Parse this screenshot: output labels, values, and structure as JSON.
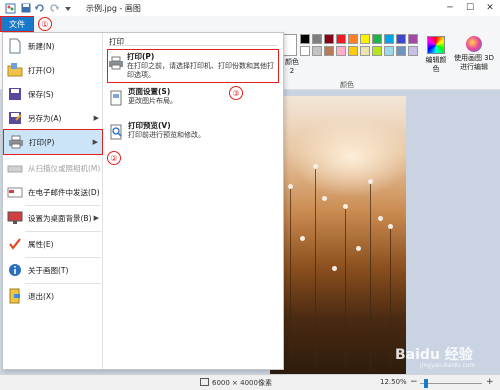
{
  "window": {
    "title": "示例.jpg - 画图",
    "controls": {
      "minimize": "─",
      "maximize": "☐",
      "close": "✕"
    }
  },
  "ribbon": {
    "file_tab": "文件",
    "color2_label": "颜色 2",
    "colors_label": "颜色",
    "edit_colors_label": "编辑颜色",
    "paint3d_label": "使用画图 3D 进行编辑",
    "swatches": [
      "#000000",
      "#7f7f7f",
      "#880015",
      "#ed1c24",
      "#ff7f27",
      "#fff200",
      "#22b14c",
      "#00a2e8",
      "#3f48cc",
      "#a349a4",
      "#ffffff",
      "#c3c3c3",
      "#b97a57",
      "#ffaec9",
      "#ffc90e",
      "#efe4b0",
      "#b5e61d",
      "#99d9ea",
      "#7092be",
      "#c8bfe7"
    ]
  },
  "file_menu": {
    "items": [
      {
        "label": "新建(N)",
        "icon": "new-file-icon",
        "disabled": false,
        "submenu": false
      },
      {
        "label": "打开(O)",
        "icon": "open-folder-icon",
        "disabled": false,
        "submenu": false
      },
      {
        "label": "保存(S)",
        "icon": "save-icon",
        "disabled": false,
        "submenu": false
      },
      {
        "label": "另存为(A)",
        "icon": "save-as-icon",
        "disabled": false,
        "submenu": true
      },
      {
        "label": "打印(P)",
        "icon": "printer-icon",
        "disabled": false,
        "submenu": true,
        "active": true
      },
      {
        "label": "从扫描仪或照相机(M)",
        "icon": "scanner-icon",
        "disabled": true,
        "submenu": false
      },
      {
        "label": "在电子邮件中发送(D)",
        "icon": "email-icon",
        "disabled": false,
        "submenu": false
      },
      {
        "label": "设置为桌面背景(B)",
        "icon": "desktop-background-icon",
        "disabled": false,
        "submenu": true
      },
      {
        "label": "属性(E)",
        "icon": "properties-check-icon",
        "disabled": false,
        "submenu": false
      },
      {
        "label": "关于画图(T)",
        "icon": "info-icon",
        "disabled": false,
        "submenu": false
      },
      {
        "label": "退出(X)",
        "icon": "exit-icon",
        "disabled": false,
        "submenu": false
      }
    ],
    "print_submenu": {
      "title": "打印",
      "items": [
        {
          "title": "打印(P)",
          "desc": "在打印之前，请选择打印机、打印份数和其他打印选项。",
          "icon": "printer-icon",
          "highlight": true
        },
        {
          "title": "页面设置(S)",
          "desc": "更改图片布局。",
          "icon": "page-setup-icon",
          "highlight": false
        },
        {
          "title": "打印预览(V)",
          "desc": "打印前进行预览和修改。",
          "icon": "print-preview-icon",
          "highlight": false
        }
      ]
    }
  },
  "annotations": [
    "①",
    "②",
    "③"
  ],
  "status": {
    "dimensions": "6000 × 4000像素",
    "zoom": "12.50%",
    "zoom_minus": "−",
    "zoom_plus": "+"
  },
  "watermark": {
    "main": "Baidu 经验",
    "sub": "jingyan.baidu.com"
  }
}
